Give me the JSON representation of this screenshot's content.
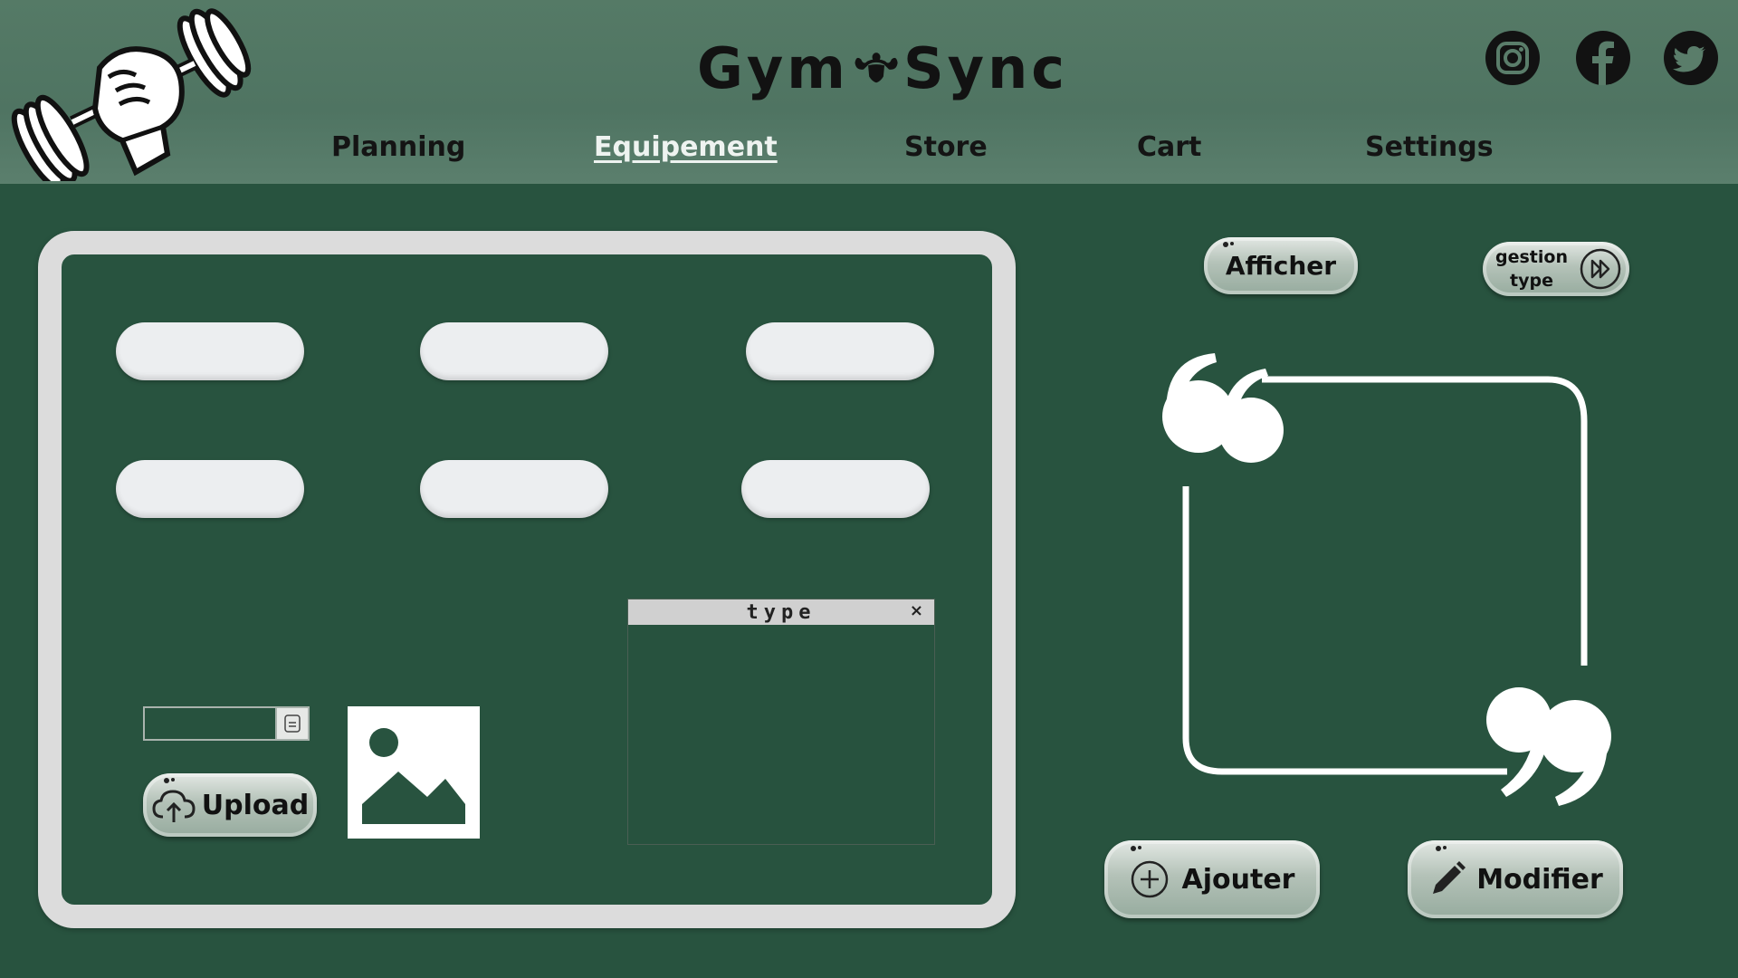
{
  "header": {
    "brand_left": "Gym",
    "brand_right": "Sync",
    "nav": [
      {
        "label": "Planning",
        "active": false
      },
      {
        "label": "Equipement",
        "active": true
      },
      {
        "label": "Store",
        "active": false
      },
      {
        "label": "Cart",
        "active": false
      },
      {
        "label": "Settings",
        "active": false
      }
    ],
    "social": [
      "instagram-icon",
      "facebook-icon",
      "twitter-icon"
    ]
  },
  "form": {
    "fields": [
      "",
      "",
      "",
      "",
      "",
      ""
    ],
    "upload_label": "Upload",
    "type_panel_title": "type",
    "type_panel_close": "×"
  },
  "actions": {
    "afficher": "Afficher",
    "gestion_type_line1": "gestion",
    "gestion_type_line2": "type",
    "ajouter": "Ajouter",
    "modifier": "Modifier"
  },
  "colors": {
    "background": "#28533f",
    "header": "#557a66",
    "panel_border": "#dcdcdc",
    "field": "#eceef0"
  }
}
